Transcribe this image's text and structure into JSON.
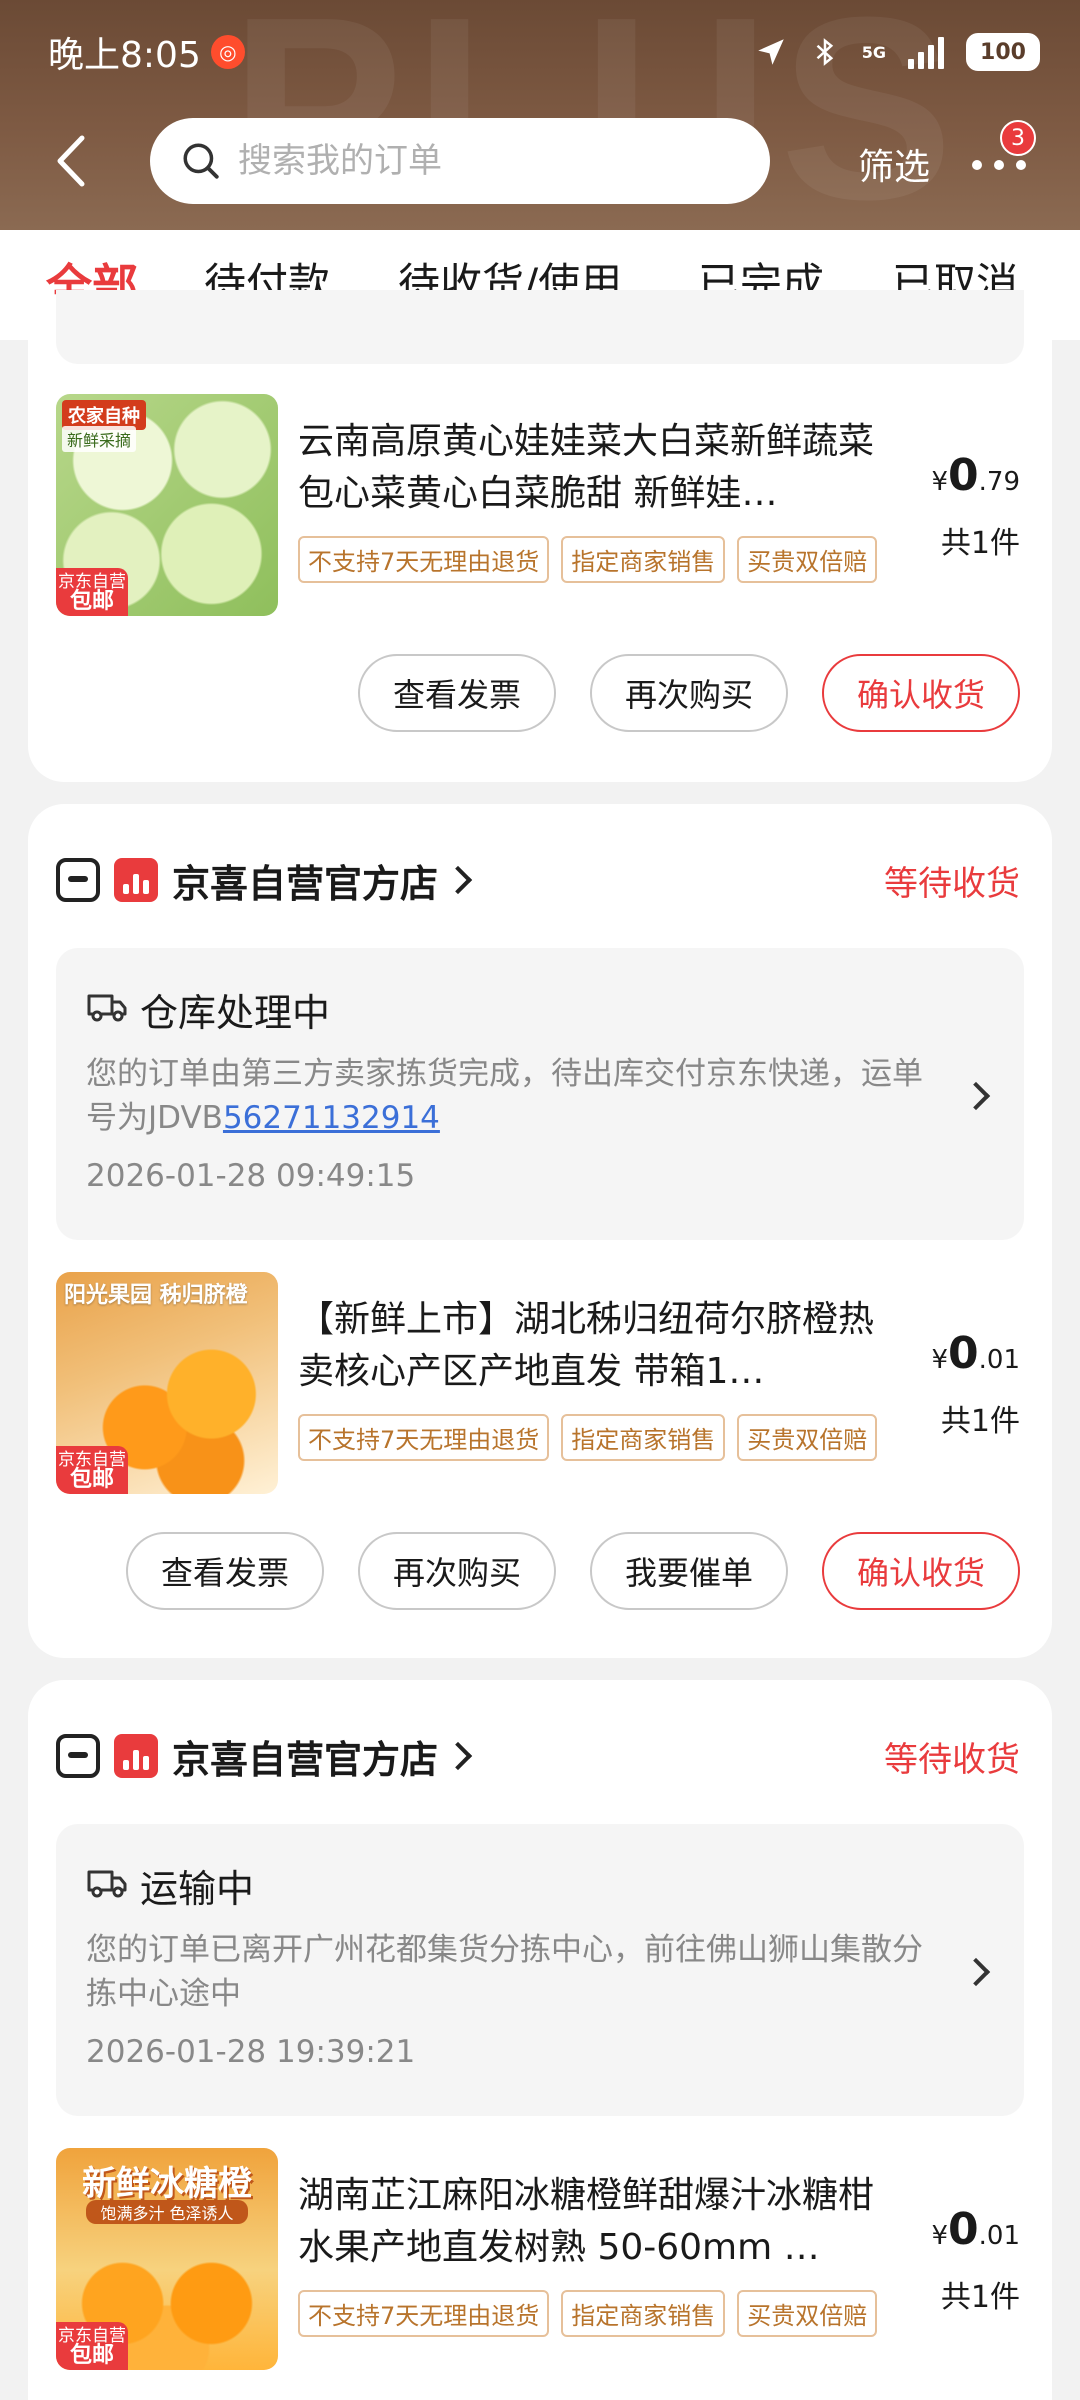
{
  "status_bar": {
    "time": "晚上8:05",
    "network": "5G",
    "battery": "100"
  },
  "header": {
    "watermark": "PLUS",
    "search_placeholder": "搜索我的订单",
    "filter_label": "筛选",
    "more_badge": "3"
  },
  "tabs": [
    {
      "label": "全部",
      "active": true
    },
    {
      "label": "待付款"
    },
    {
      "label": "待收货/使用"
    },
    {
      "label": "已完成"
    },
    {
      "label": "已取消"
    }
  ],
  "orders": [
    {
      "product": {
        "name": "云南高原黄心娃娃菜大白菜新鲜蔬菜包心菜黄心白菜脆甜 新鲜娃…",
        "image_tag": "农家自种",
        "image_sub": "新鲜采摘",
        "ship_top": "京东自营",
        "ship_bottom": "包邮",
        "price_symbol": "¥",
        "price_int": "0",
        "price_dec": ".79",
        "qty": "共1件",
        "tags": [
          "不支持7天无理由退货",
          "指定商家销售",
          "买贵双倍赔"
        ]
      },
      "actions": [
        "查看发票",
        "再次购买",
        "确认收货"
      ]
    },
    {
      "shop": {
        "name": "京喜自营官方店",
        "status": "等待收货"
      },
      "logistic": {
        "title": "仓库处理中",
        "desc_prefix": "您的订单由第三方卖家拣货完成，待出库交付京东快递，运单号为JDVB",
        "tracking": "56271132914",
        "time": "2026-01-28 09:49:15"
      },
      "product": {
        "name": "【新鲜上市】湖北秭归纽荷尔脐橙热卖核心产区产地直发 带箱1…",
        "image_title": "阳光果园 秭归脐橙",
        "ship_top": "京东自营",
        "ship_bottom": "包邮",
        "price_symbol": "¥",
        "price_int": "0",
        "price_dec": ".01",
        "qty": "共1件",
        "tags": [
          "不支持7天无理由退货",
          "指定商家销售",
          "买贵双倍赔"
        ]
      },
      "actions": [
        "查看发票",
        "再次购买",
        "我要催单",
        "确认收货"
      ]
    },
    {
      "shop": {
        "name": "京喜自营官方店",
        "status": "等待收货"
      },
      "logistic": {
        "title": "运输中",
        "desc": "您的订单已离开广州花都集货分拣中心，前往佛山狮山集散分拣中心途中",
        "time": "2026-01-28 19:39:21"
      },
      "product": {
        "name": "湖南芷江麻阳冰糖橙鲜甜爆汁冰糖柑水果产地直发树熟 50-60mm …",
        "image_title": "新鲜冰糖橙",
        "image_sub": "饱满多汁 色泽诱人",
        "ship_top": "京东自营",
        "ship_bottom": "包邮",
        "price_symbol": "¥",
        "price_int": "0",
        "price_dec": ".01",
        "qty": "共1件",
        "tags": [
          "不支持7天无理由退货",
          "指定商家销售",
          "买贵双倍赔"
        ]
      }
    }
  ]
}
